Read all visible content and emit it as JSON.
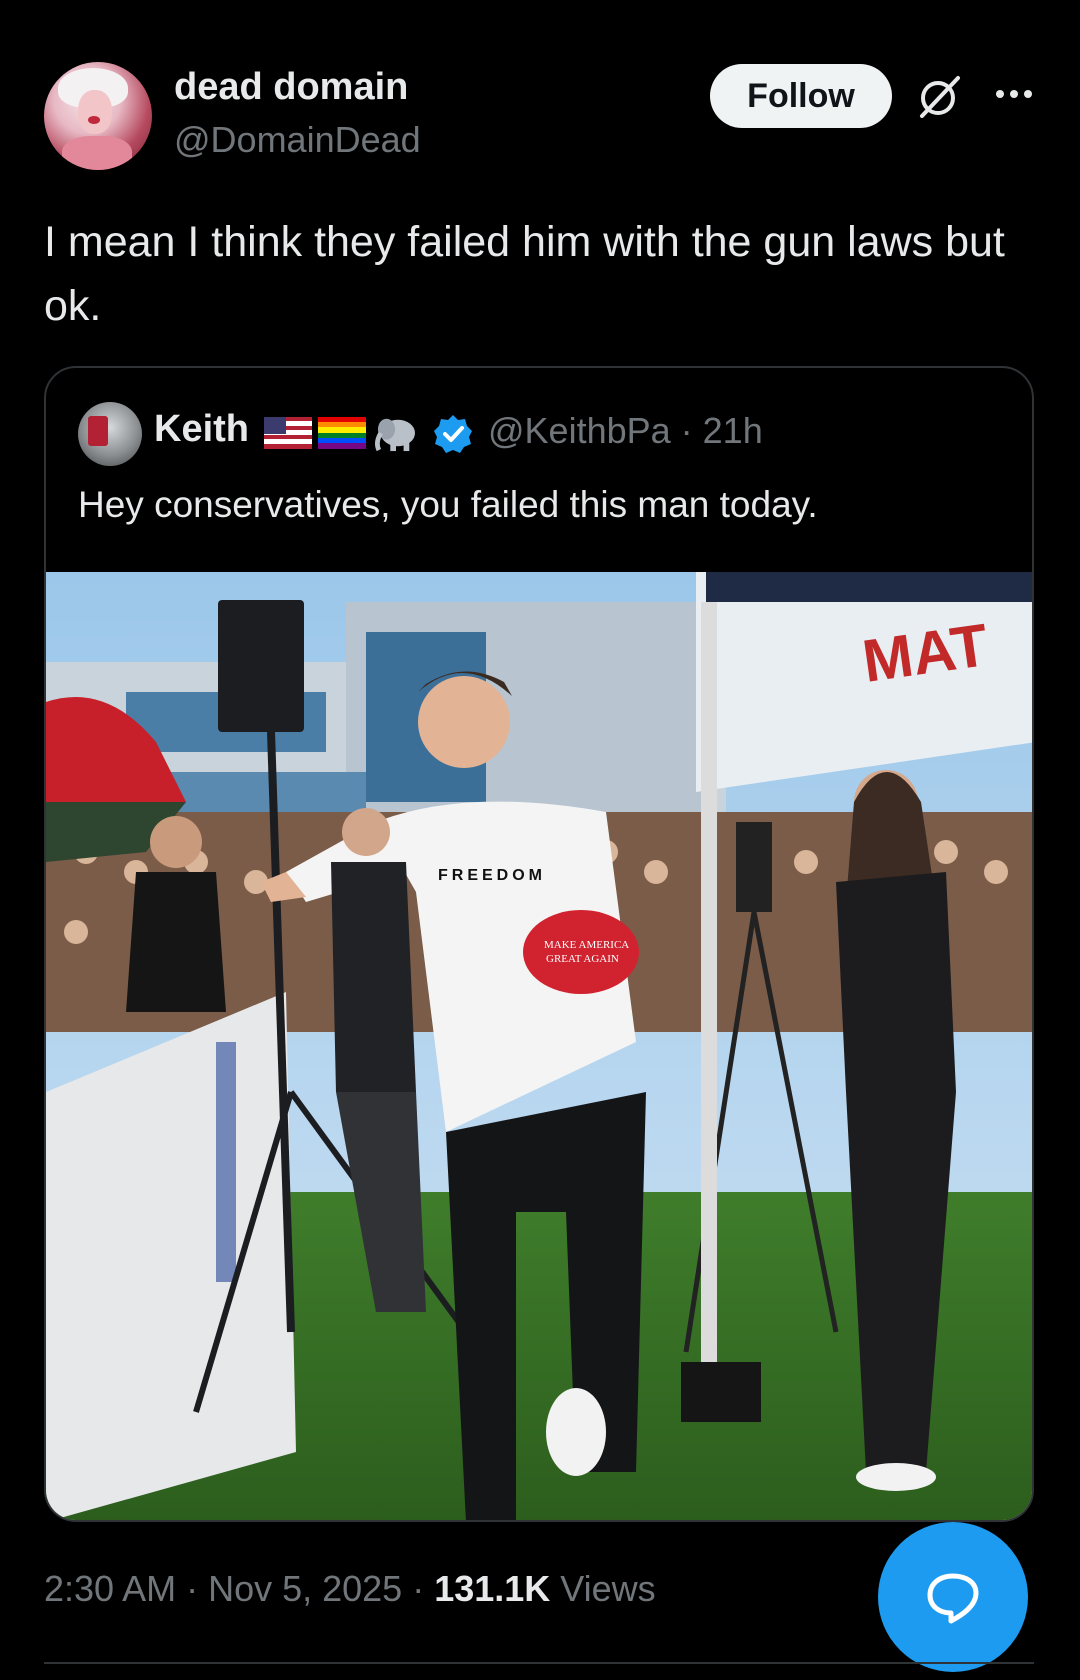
{
  "post": {
    "author_name": "dead domain",
    "author_handle": "@DomainDead",
    "follow_label": "Follow",
    "text": "I mean I think they failed him with the gun laws but ok.",
    "timestamp": "2:30 AM · Nov 5, 2025 · ",
    "views_count": "131.1K",
    "views_label": " Views"
  },
  "quote": {
    "author_name": "Keith",
    "emojis": [
      "us-flag",
      "rainbow-flag",
      "elephant"
    ],
    "verified": true,
    "handle_time": "@KeithbPa · 21h",
    "text": "Hey conservatives, you failed this man today.",
    "photo": {
      "shirt_text": "FREEDOM",
      "hat_text_line1": "MAKE AMERICA",
      "hat_text_line2": "GREAT AGAIN"
    }
  },
  "icons": {
    "grok": "grok-icon",
    "more": "more-dots-icon",
    "reply": "reply-bubble-icon"
  },
  "colors": {
    "background": "#000000",
    "accent": "#1d9bf0",
    "text_primary": "#e7e9ea",
    "text_secondary": "#71767b",
    "border": "#2f3336"
  }
}
